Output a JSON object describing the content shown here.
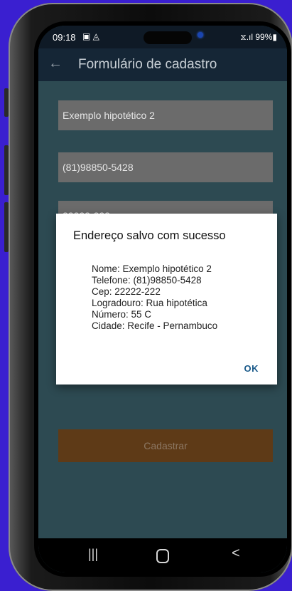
{
  "status_bar": {
    "time": "09:18",
    "left_icons": "▣ ◬",
    "right": "⧖.ıl 99%▮"
  },
  "app_bar": {
    "back_icon": "arrow-left-icon",
    "title": "Formulário de cadastro"
  },
  "form": {
    "name_value": "Exemplo hipotético 2",
    "phone_value": "(81)98850-5428",
    "cep_value": "22222-222",
    "submit_label": "Cadastrar"
  },
  "dialog": {
    "title": "Endereço salvo com sucesso",
    "lines": [
      "Nome: Exemplo hipotético 2",
      "Telefone: (81)98850-5428",
      "Cep: 22222-222",
      "Logradouro: Rua hipotética",
      "Número: 55 C",
      "Cidade: Recife - Pernambuco"
    ],
    "ok_label": "OK"
  },
  "nav_bar": {
    "recents": "|||",
    "back": "<"
  },
  "colors": {
    "background": "#3a1fd0",
    "app_bar": "#152636",
    "screen_bg": "#2d4a52",
    "field_bg": "#6b6b6b",
    "submit_bg": "#5e3a17",
    "ok_text": "#1a5a8a"
  }
}
